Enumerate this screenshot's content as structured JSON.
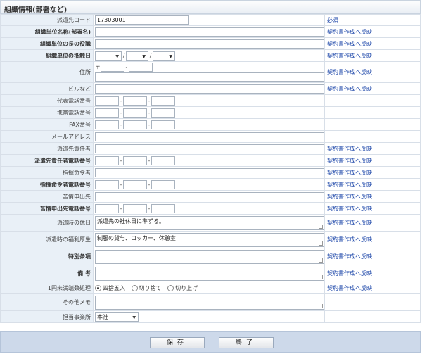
{
  "section_title": "組織情報(部署など)",
  "link_text": "契約書作成へ反映",
  "fields": {
    "dest_code": {
      "label": "派遣先コード",
      "value": "17303001",
      "note": "必須"
    },
    "org_name": {
      "label": "組織単位名称(部署名)"
    },
    "org_head_title": {
      "label": "組織単位の長の役職"
    },
    "conflict_date": {
      "label": "組織単位の抵触日"
    },
    "address": {
      "label": "住所",
      "postal_mark": "〒"
    },
    "building": {
      "label": "ビルなど"
    },
    "main_phone": {
      "label": "代表電話番号"
    },
    "mobile_phone": {
      "label": "携帯電話番号"
    },
    "fax": {
      "label": "FAX番号"
    },
    "email": {
      "label": "メールアドレス"
    },
    "dest_manager": {
      "label": "派遣先責任者"
    },
    "dest_manager_phone": {
      "label": "派遣先責任者電話番号"
    },
    "commander": {
      "label": "指揮命令者"
    },
    "commander_phone": {
      "label": "指揮命令者電話番号"
    },
    "complaint": {
      "label": "苦情申出先"
    },
    "complaint_phone": {
      "label": "苦情申出先電話番号"
    },
    "holidays": {
      "label": "派遣時の休日",
      "value": "派遣先の社休日に準ずる。"
    },
    "welfare": {
      "label": "派遣時の福利厚生",
      "value": "制服の貸与、ロッカー、休憩室"
    },
    "special": {
      "label": "特別条項"
    },
    "remarks": {
      "label": "備 考"
    },
    "rounding": {
      "label": "1円未満端数処理",
      "options": [
        "四捨五入",
        "切り捨て",
        "切り上げ"
      ],
      "selected": "四捨五入"
    },
    "other_memo": {
      "label": "その他メモ"
    },
    "office": {
      "label": "担当事業所",
      "value": "本社"
    }
  },
  "buttons": {
    "save": "保存",
    "close": "終了"
  }
}
